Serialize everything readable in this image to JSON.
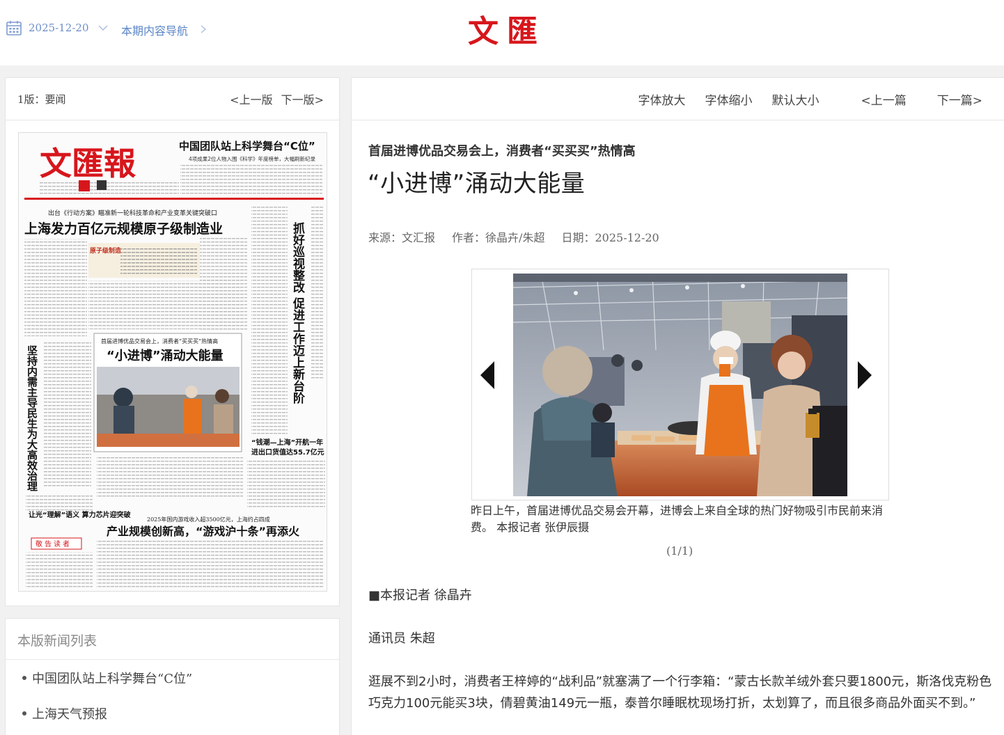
{
  "header": {
    "date": "2025-12-20",
    "nav_label": "本期内容导航",
    "logo_text": "文匯"
  },
  "edition": {
    "label": "1版：要闻",
    "prev": "<上一版",
    "next": "下一版>"
  },
  "frontpage": {
    "masthead": "文匯報",
    "top_headline": "中国团队站上科学舞台“C位”",
    "top_sub": "4项成果2位人物入围《科学》年度榜单，大幅刷新纪录",
    "lead_kicker": "出台《行动方案》瞄准新一轮科技革命和产业变革关键突破口",
    "lead_headline": "上海发力百亿元规模原子级制造业",
    "tag_atomic": "原子级制造",
    "right_column_headline": "抓好巡视整改 促进工作迈上新台阶",
    "left_column_headline": "坚持内需主导民生为大高效治理",
    "inset_kicker": "首届进博优品交易会上，消费者“买买买”热情高",
    "inset_headline": "“小进博”涌动大能量",
    "box_kicker": "“钱潮—上海”开航一年",
    "box_headline": "进出口货值达55.7亿元",
    "game_kicker": "2025年国内游戏收入超3500亿元，上海约占四成",
    "game_headline": "产业规模创新高，“游戏沪十条”再添火",
    "small_box": "让光“理解”语义 算力芯片迎突破",
    "notice": "敬告读者"
  },
  "news_list": {
    "title": "本版新闻列表",
    "items": [
      "中国团队站上科学舞台“C位”",
      "上海天气预报"
    ]
  },
  "article": {
    "tools": {
      "enlarge": "字体放大",
      "shrink": "字体缩小",
      "default": "默认大小",
      "prev": "<上一篇",
      "next": "下一篇>"
    },
    "subtitle": "首届进博优品交易会上，消费者“买买买”热情高",
    "headline": "“小进博”涌动大能量",
    "meta": {
      "source_label": "来源：",
      "source": "文汇报",
      "author_label": "作者：",
      "author": "徐晶卉/朱超",
      "date_label": "日期：",
      "date": "2025-12-20"
    },
    "photo_caption": "昨日上午，首届进博优品交易会开幕，进博会上来自全球的热门好物吸引市民前来消费。 本报记者 张伊辰摄",
    "photo_counter": "(1/1)",
    "paragraphs": [
      "■本报记者 徐晶卉",
      "通讯员 朱超",
      "逛展不到2小时，消费者王梓婷的“战利品”就塞满了一个行李箱：“蒙古长款羊绒外套只要1800元，斯洛伐克粉色巧克力100元能买3块，倩碧黄油149元一瓶，泰普尔睡眠枕现场打折，太划算了，而且很多商品外面买不到。”"
    ]
  },
  "colors": {
    "accent_blue": "#5b86c8",
    "logo_red": "#d7161c",
    "apron_orange": "#e8731c"
  },
  "icons": [
    "calendar-icon",
    "chevron-down-icon",
    "chevron-right-icon",
    "arrow-left-icon",
    "arrow-right-icon"
  ]
}
